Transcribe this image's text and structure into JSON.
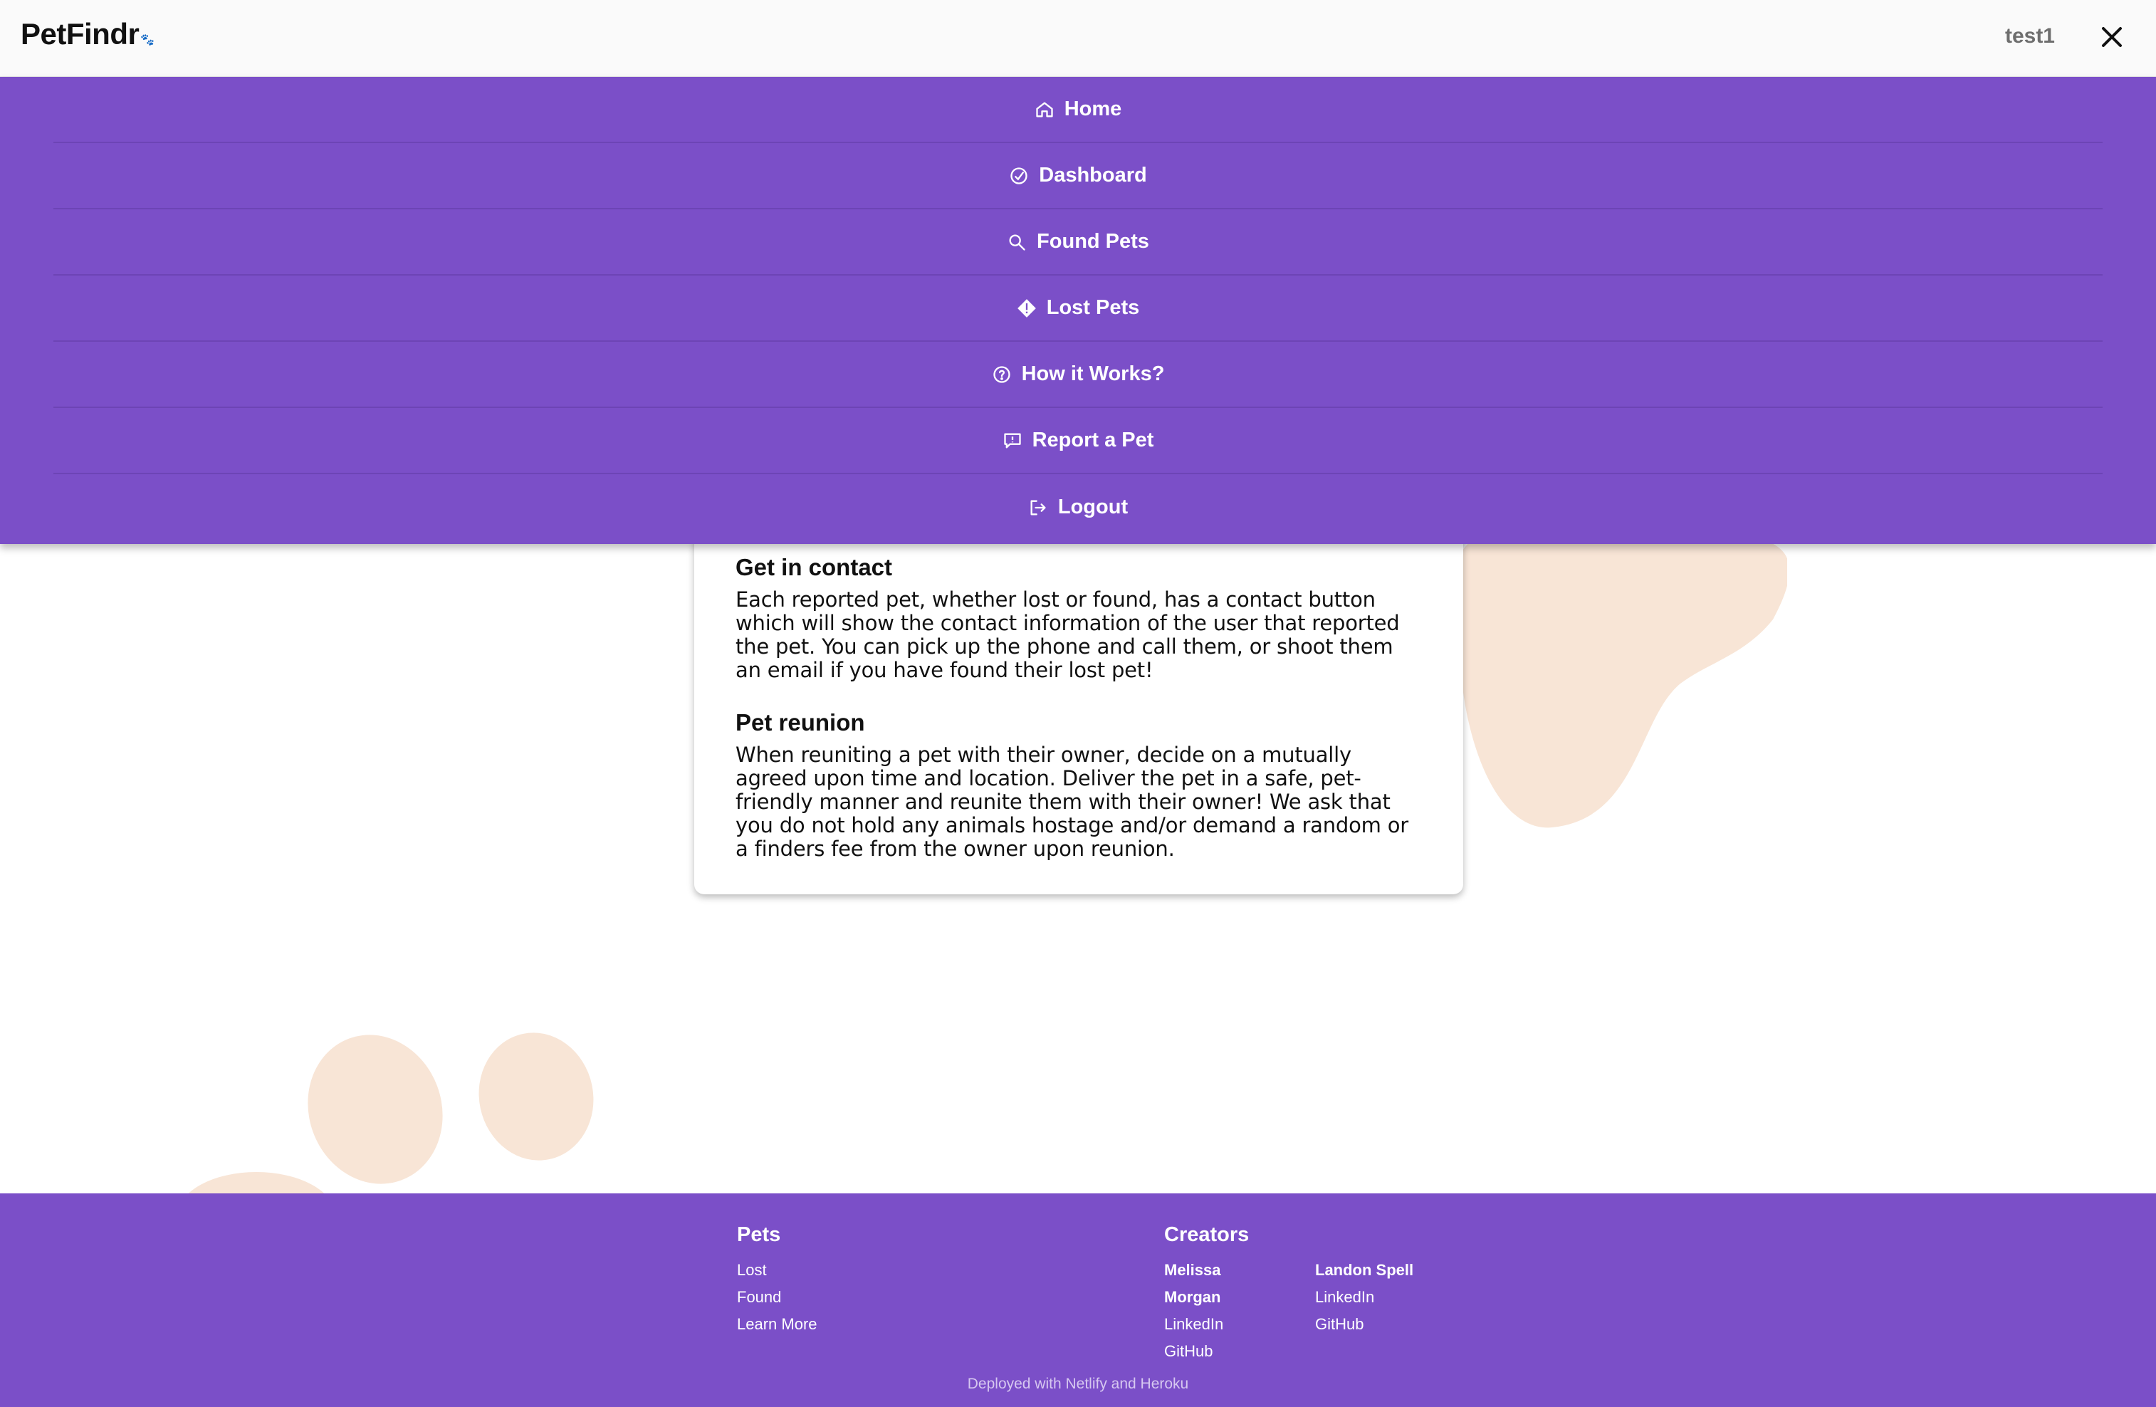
{
  "header": {
    "logo_text": "PetFindr",
    "username": "test1",
    "close_icon": "close-icon"
  },
  "menu": {
    "items": [
      {
        "label": "Home",
        "icon": "home-icon"
      },
      {
        "label": "Dashboard",
        "icon": "dashboard-gauge-icon"
      },
      {
        "label": "Found Pets",
        "icon": "search-icon"
      },
      {
        "label": "Lost Pets",
        "icon": "warning-diamond-icon"
      },
      {
        "label": "How it Works?",
        "icon": "question-circle-icon"
      },
      {
        "label": "Report a Pet",
        "icon": "report-message-icon"
      },
      {
        "label": "Logout",
        "icon": "logout-icon"
      }
    ]
  },
  "card": {
    "sections": [
      {
        "heading": "Get in contact",
        "body": "Each reported pet, whether lost or found, has a contact button which will show the contact information of the user that reported the pet. You can pick up the phone and call them, or shoot them an email if you have found their lost pet!"
      },
      {
        "heading": "Pet reunion",
        "body": "When reuniting a pet with their owner, decide on a mutually agreed upon time and location. Deliver the pet in a safe, pet-friendly manner and reunite them with their owner! We ask that you do not hold any animals hostage and/or demand a random or a finders fee from the owner upon reunion."
      }
    ]
  },
  "footer": {
    "pets": {
      "title": "Pets",
      "links": [
        "Lost",
        "Found",
        "Learn More"
      ]
    },
    "creators": {
      "title": "Creators",
      "people": [
        {
          "name": "Melissa Morgan",
          "links": [
            "LinkedIn",
            "GitHub"
          ]
        },
        {
          "name": "Landon Spell",
          "links": [
            "LinkedIn",
            "GitHub"
          ]
        }
      ]
    },
    "deployed": "Deployed with Netlify and Heroku"
  },
  "colors": {
    "brand_purple": "#7b4fc8",
    "blob_peach": "#f8e5d6",
    "topbar_bg": "#fafafa"
  }
}
